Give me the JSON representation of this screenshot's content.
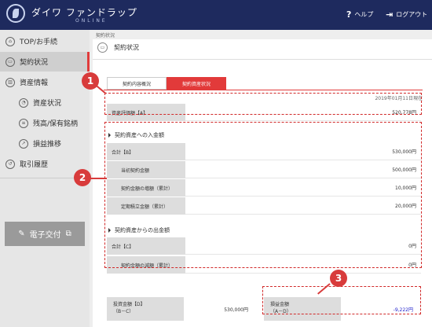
{
  "header": {
    "logo_text": "ダイワ ファンドラップ",
    "logo_sub": "ONLINE",
    "help": "ヘルプ",
    "logout": "ログアウト"
  },
  "sidebar": {
    "items": [
      {
        "label": "TOP/お手続",
        "icon": "home-icon"
      },
      {
        "label": "契約状況",
        "icon": "contract-icon"
      },
      {
        "label": "資産情報",
        "icon": "chart-icon"
      },
      {
        "label": "資産状況",
        "icon": "pie-icon"
      },
      {
        "label": "残高/保有銘柄",
        "icon": "list-icon"
      },
      {
        "label": "損益推移",
        "icon": "trend-icon"
      },
      {
        "label": "取引履歴",
        "icon": "history-icon"
      }
    ],
    "doc_button": "電子交付"
  },
  "main": {
    "breadcrumb": "契約状況",
    "page_title": "契約状況",
    "tabs": [
      "契約内容概況",
      "契約資産状況"
    ],
    "date": "2019年01月11日現在",
    "valuation": {
      "label": "資産評価額【A】",
      "value": "520,778円"
    },
    "inflow_title": "契約資産への入金額",
    "inflow_rows": [
      {
        "label": "合計【B】",
        "value": "530,000円"
      },
      {
        "label": "当初契約金額",
        "value": "500,000円"
      },
      {
        "label": "契約金額の増額（累計）",
        "value": "10,000円"
      },
      {
        "label": "定期積立金額（累計）",
        "value": "20,000円"
      }
    ],
    "outflow_title": "契約資産からの出金額",
    "outflow_rows": [
      {
        "label": "合計【C】",
        "value": "0円"
      },
      {
        "label": "契約金額の減額（累計）",
        "value": "0円"
      }
    ],
    "investment": {
      "label1": "投資金額【D】",
      "label2": "（B－C）",
      "value": "530,000円"
    },
    "profit": {
      "label1": "損益金額",
      "label2": "（A－D）",
      "value": "-9,222円"
    }
  },
  "callouts": [
    "1",
    "2",
    "3"
  ],
  "colors": {
    "accent": "#d83b3b",
    "header": "#1e2a5e",
    "negative": "#2222cc"
  }
}
